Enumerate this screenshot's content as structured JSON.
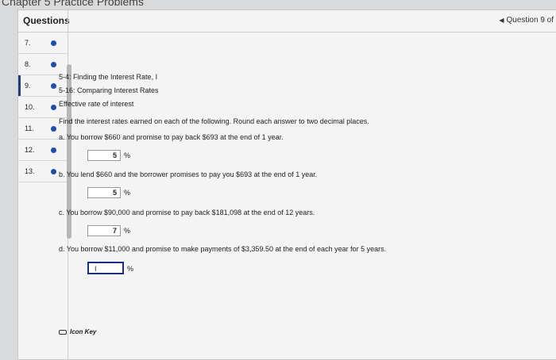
{
  "window": {
    "title": "Chapter 5 Practice Problems"
  },
  "sidebar": {
    "header": "Questions",
    "items": [
      {
        "label": "7."
      },
      {
        "label": "8."
      },
      {
        "label": "9."
      },
      {
        "label": "10."
      },
      {
        "label": "11."
      },
      {
        "label": "12."
      },
      {
        "label": "13."
      }
    ]
  },
  "nav": {
    "label": "Question 9 of"
  },
  "question": {
    "line1": "5-4: Finding the Interest Rate, I",
    "line2": "5-16: Comparing Interest Rates",
    "line3": "Effective rate of interest",
    "instructions": "Find the interest rates earned on each of the following. Round each answer to two decimal places.",
    "parts": [
      {
        "text": "a. You borrow $660 and promise to pay back $693 at the end of 1 year.",
        "value": "5",
        "unit": "%"
      },
      {
        "text": "b. You lend $660 and the borrower promises to pay you $693 at the end of 1 year.",
        "value": "5",
        "unit": "%"
      },
      {
        "text": "c. You borrow $90,000 and promise to pay back $181,098 at the end of 12 years.",
        "value": "7",
        "unit": "%"
      },
      {
        "text": "d. You borrow $11,000 and promise to make payments of $3,359.50 at the end of each year for 5 years.",
        "value": "",
        "unit": "%"
      }
    ]
  },
  "footer": {
    "icon_key": "Icon Key"
  }
}
